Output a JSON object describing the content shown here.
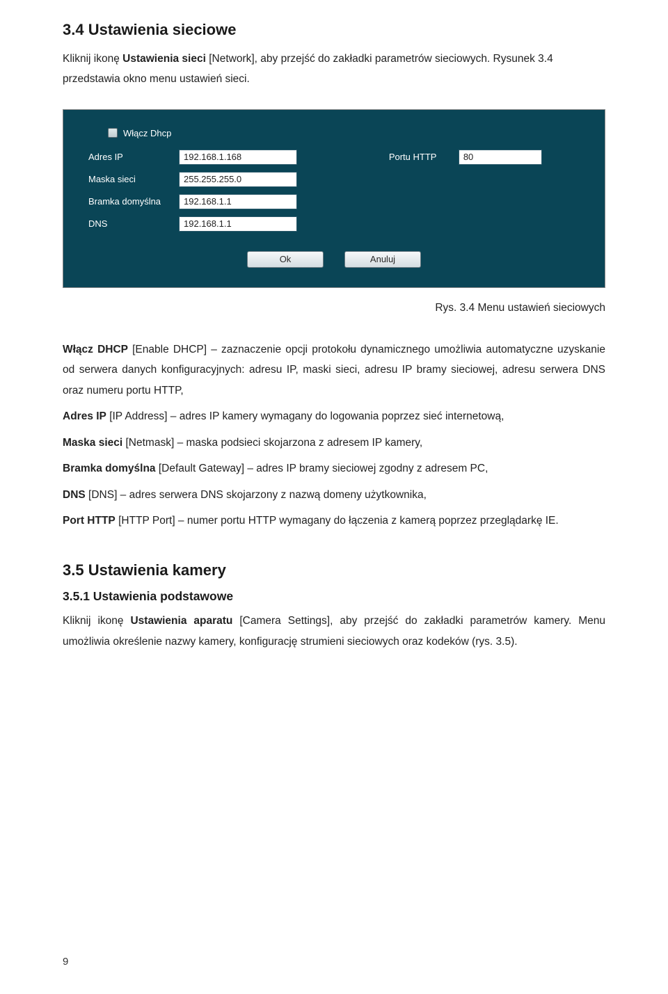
{
  "section34": {
    "heading": "3.4 Ustawienia sieciowe",
    "intro_pre": "Kliknij ikonę ",
    "intro_bold": "Ustawienia sieci",
    "intro_post": " [Network], aby przejść do zakładki parametrów sieciowych. Rysunek 3.4 przedstawia okno menu ustawień sieci."
  },
  "panel": {
    "dhcp_label": "Włącz Dhcp",
    "rows_left": [
      {
        "label": "Adres IP",
        "value": "192.168.1.168"
      },
      {
        "label": "Maska sieci",
        "value": "255.255.255.0"
      },
      {
        "label": "Bramka domyślna",
        "value": "192.168.1.1"
      },
      {
        "label": "DNS",
        "value": "192.168.1.1"
      }
    ],
    "row_right": {
      "label": "Portu HTTP",
      "value": "80"
    },
    "btn_ok": "Ok",
    "btn_cancel": "Anuluj"
  },
  "caption": "Rys. 3.4 Menu ustawień sieciowych",
  "descriptions": {
    "dhcp": {
      "b": "Włącz DHCP",
      "t": " [Enable DHCP] – zaznaczenie opcji protokołu dynamicznego umożliwia automatyczne uzyskanie od serwera danych konfiguracyjnych: adresu IP, maski sieci, adresu IP bramy sieciowej, adresu serwera DNS oraz numeru portu HTTP,"
    },
    "ip": {
      "b": "Adres IP",
      "t": " [IP Address] – adres IP kamery wymagany do logowania poprzez sieć internetową,"
    },
    "mask": {
      "b": "Maska sieci",
      "t": " [Netmask] – maska podsieci skojarzona z adresem IP kamery,"
    },
    "gw": {
      "b": "Bramka domyślna",
      "t": " [Default Gateway] – adres IP bramy sieciowej zgodny z adresem PC,"
    },
    "dns": {
      "b": "DNS",
      "t": " [DNS] – adres serwera DNS skojarzony z nazwą domeny użytkownika,"
    },
    "port": {
      "b": "Port HTTP",
      "t": " [HTTP Port] – numer portu HTTP wymagany do łączenia z kamerą poprzez przeglądarkę IE."
    }
  },
  "section35": {
    "heading": "3.5 Ustawienia kamery",
    "sub": "3.5.1 Ustawienia podstawowe",
    "p_pre": "Kliknij ikonę ",
    "p_bold": "Ustawienia aparatu",
    "p_post": " [Camera Settings], aby przejść do zakładki parametrów kamery. Menu umożliwia określenie nazwy kamery, konfigurację strumieni sieciowych oraz kodeków (rys. 3.5)."
  },
  "page_number": "9"
}
